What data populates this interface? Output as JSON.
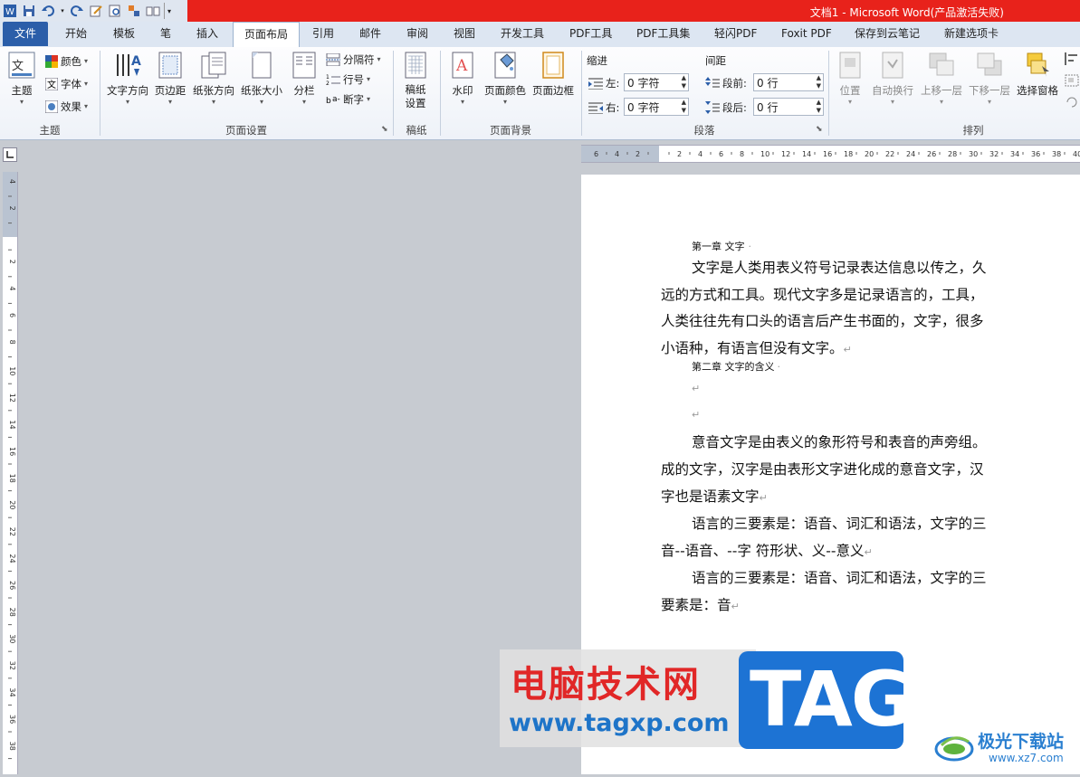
{
  "titlebar": {
    "title": "文档1 - Microsoft Word(产品激活失败)"
  },
  "tabs": [
    "文件",
    "开始",
    "模板",
    "笔",
    "插入",
    "页面布局",
    "引用",
    "邮件",
    "审阅",
    "视图",
    "开发工具",
    "PDF工具",
    "PDF工具集",
    "轻闪PDF",
    "Foxit PDF",
    "保存到云笔记",
    "新建选项卡"
  ],
  "active_tab": "页面布局",
  "ribbon": {
    "theme": {
      "big": "主题",
      "colors": "颜色",
      "fonts": "字体",
      "effects": "效果",
      "group": "主题"
    },
    "page_setup": {
      "text_direction": "文字方向",
      "margins": "页边距",
      "orientation": "纸张方向",
      "size": "纸张大小",
      "columns": "分栏",
      "breaks": "分隔符",
      "line_numbers": "行号",
      "hyphenation": "断字",
      "group": "页面设置"
    },
    "manuscript": {
      "button": "稿纸\n设置",
      "group": "稿纸"
    },
    "page_background": {
      "watermark": "水印",
      "page_color": "页面颜色",
      "page_borders": "页面边框",
      "group": "页面背景"
    },
    "paragraph": {
      "indent_label": "缩进",
      "spacing_label": "间距",
      "left_label": "左:",
      "left_value": "0 字符",
      "right_label": "右:",
      "right_value": "0 字符",
      "before_label": "段前:",
      "before_value": "0 行",
      "after_label": "段后:",
      "after_value": "0 行",
      "group": "段落"
    },
    "arrange": {
      "position": "位置",
      "wrap": "自动换行",
      "bring_forward": "上移一层",
      "send_backward": "下移一层",
      "selection_pane": "选择窗格",
      "group": "排列"
    }
  },
  "hruler_labels": [
    "6",
    "4",
    "2",
    "",
    "2",
    "4",
    "6",
    "8",
    "10",
    "12",
    "14",
    "16",
    "18",
    "20",
    "22",
    "24",
    "26",
    "28",
    "30",
    "32",
    "34",
    "36",
    "38",
    "40"
  ],
  "vruler_labels": [
    "4",
    "2",
    "",
    "2",
    "4",
    "6",
    "8",
    "10",
    "12",
    "14",
    "16",
    "18",
    "20",
    "22",
    "24",
    "26",
    "28",
    "30",
    "32",
    "34",
    "36",
    "38"
  ],
  "document": {
    "ch1_heading": "第一章 文字",
    "p1": [
      "文字是人类用表义符号记录表达信息以传之，久",
      "远的方式和工具。现代文字多是记录语言的，工具，",
      "人类往往先有口头的语言后产生书面的，文字，很多",
      "小语种，有语言但没有文字。"
    ],
    "ch2_heading": "第二章 文字的含义",
    "p2": [
      "意音文字是由表义的象形符号和表音的声旁组。",
      "成的文字，汉字是由表形文字进化成的意音文字，汉",
      "字也是语素文字"
    ],
    "p3": [
      "语言的三要素是：语音、词汇和语法，文字的三",
      "音--语音、--字  符形状、义--意义"
    ],
    "p4": [
      "语言的三要素是：语音、词汇和语法，文字的三",
      "要素是：音"
    ],
    "para_mark": "↵"
  },
  "watermark": {
    "cn_title": "电脑技术网",
    "url": "www.tagxp.com",
    "tag": "TAG",
    "site_name": "极光下载站",
    "site_url": "www.xz7.com"
  }
}
